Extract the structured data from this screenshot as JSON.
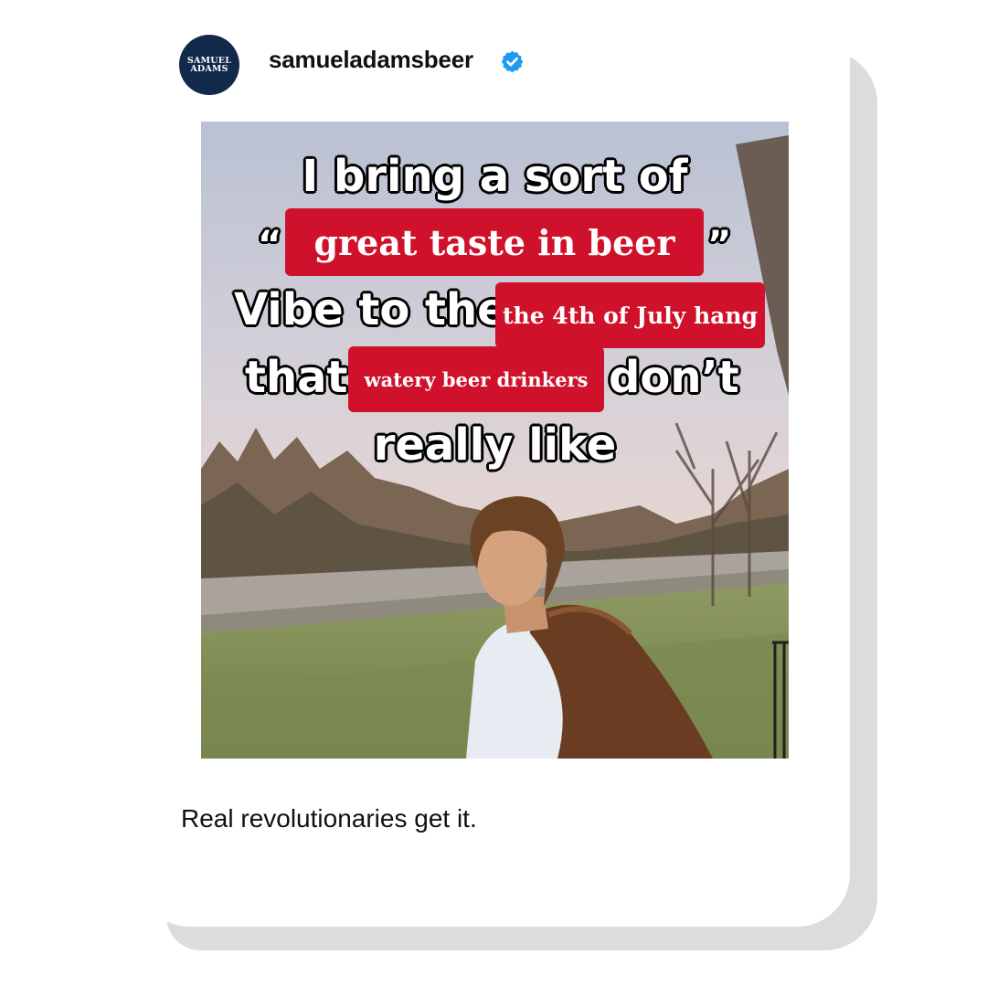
{
  "post": {
    "account": {
      "username": "samueladamsbeer",
      "verified": true,
      "avatar_text": [
        "SAMUEL",
        "ADAMS"
      ],
      "avatar_color": "#13294b",
      "verified_color": "#1d9bf0"
    },
    "media": {
      "overlay": {
        "line1": "I bring a sort of",
        "open_quote": "“",
        "close_quote": "”",
        "highlight1": "great taste in beer",
        "line3_prefix": "Vibe to the",
        "highlight2": "the 4th of July hang",
        "line4_prefix": "that",
        "highlight3": "watery beer drinkers",
        "line4_suffix": "don’t",
        "line5": "really like",
        "highlight_color": "#d0112b"
      }
    },
    "caption": "Real revolutionaries get it."
  }
}
